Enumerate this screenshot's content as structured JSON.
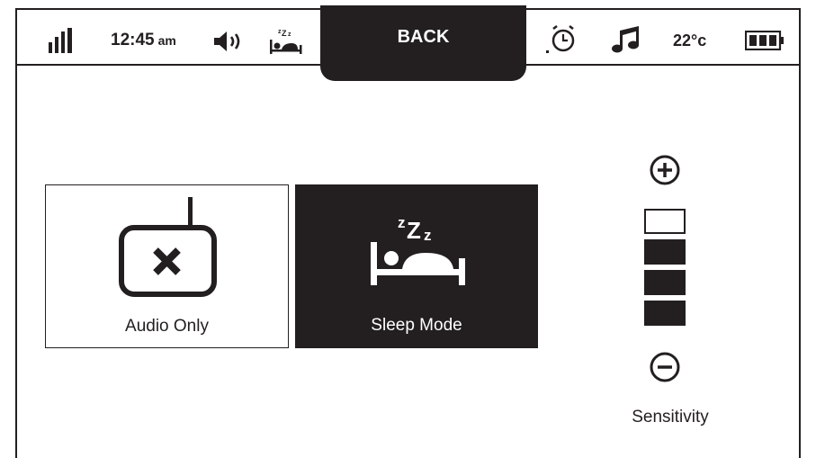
{
  "status_bar": {
    "time": "12:45",
    "time_suffix": "am",
    "temperature": "22°c",
    "icons": [
      "signal-strength-icon",
      "speaker-volume-icon",
      "sleep-mode-icon",
      "alarm-clock-icon",
      "music-note-icon",
      "battery-icon"
    ]
  },
  "back_button": {
    "label": "BACK"
  },
  "modes": [
    {
      "label": "Audio Only",
      "icon": "no-video-monitor-icon",
      "selected": false
    },
    {
      "label": "Sleep Mode",
      "icon": "sleep-bed-icon",
      "selected": true
    }
  ],
  "sensitivity": {
    "label": "Sensitivity",
    "level": 3,
    "max_level": 4,
    "increase_icon": "plus-circle-icon",
    "decrease_icon": "minus-circle-icon"
  },
  "colors": {
    "foreground": "#231f20",
    "background": "#ffffff"
  }
}
